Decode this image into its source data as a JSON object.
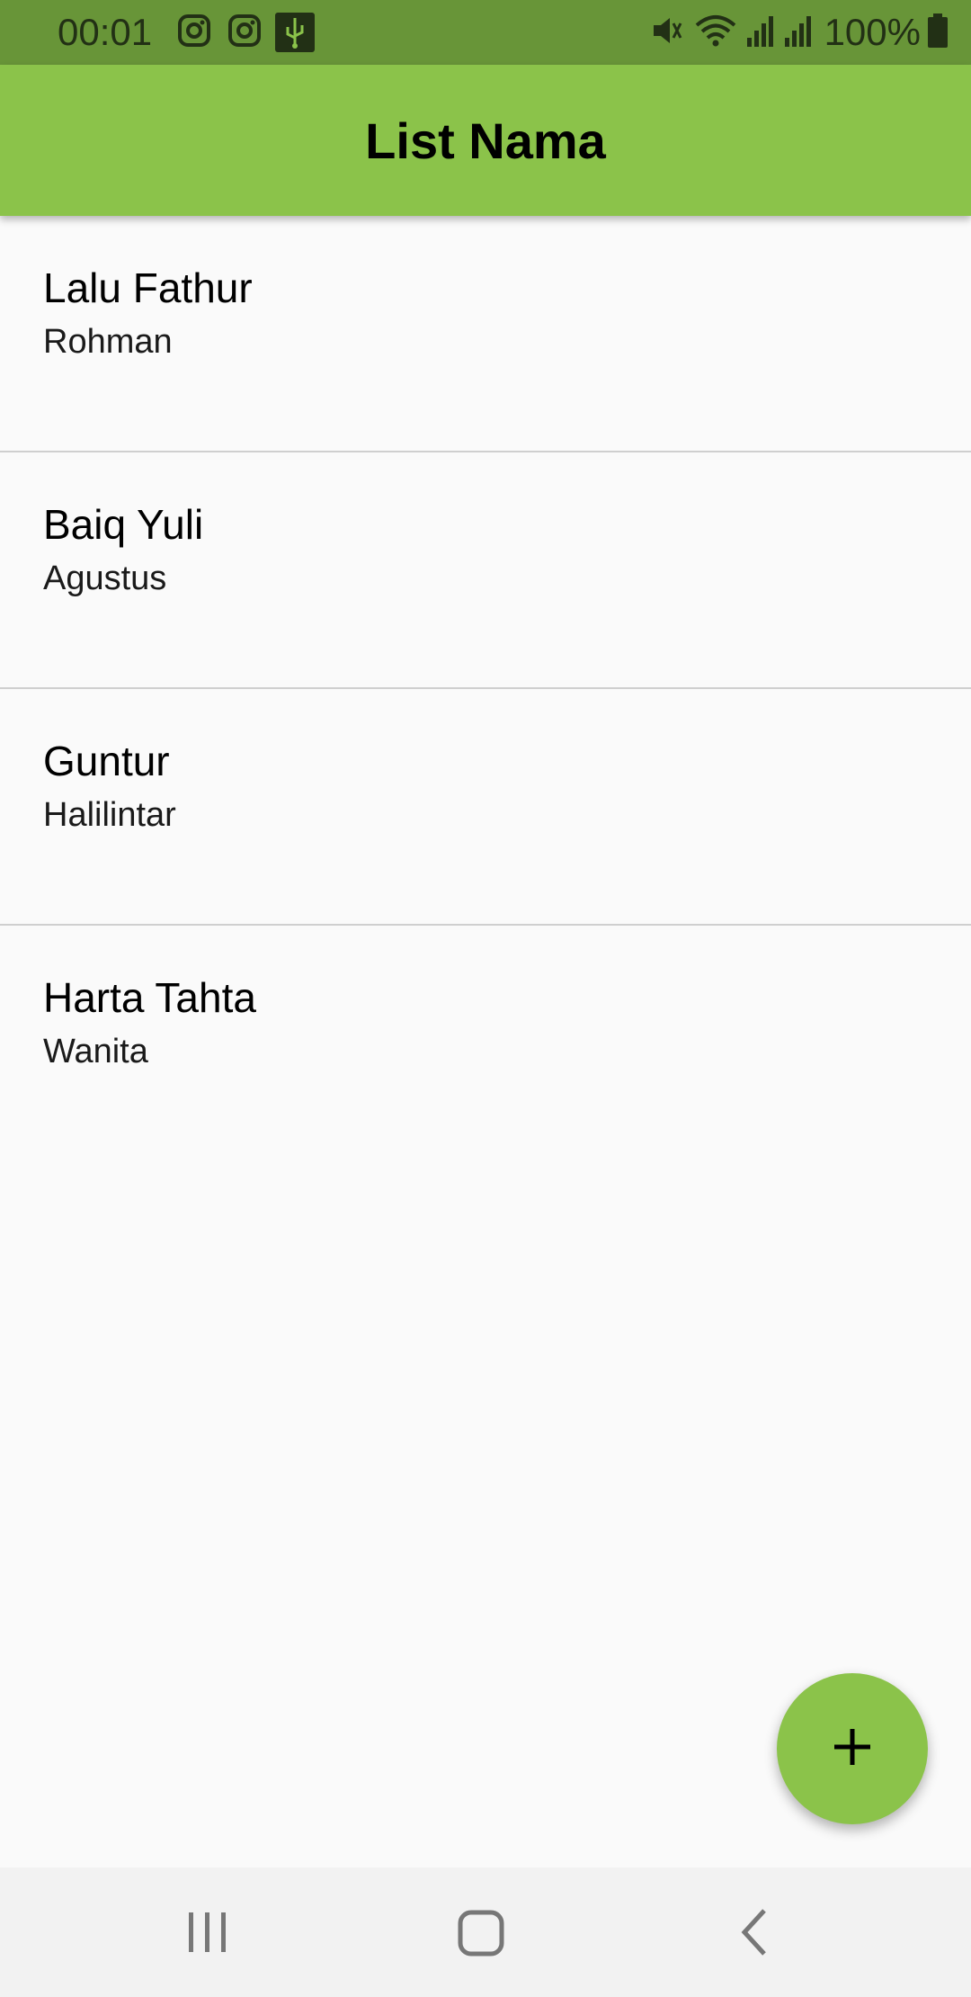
{
  "status_bar": {
    "time": "00:01",
    "battery": "100%",
    "left_icons": [
      "instagram-icon",
      "instagram-icon",
      "usb-icon"
    ],
    "right_icons": [
      "mute-icon",
      "wifi-icon",
      "signal-icon",
      "signal-icon",
      "battery-icon"
    ]
  },
  "app_bar": {
    "title": "List Nama"
  },
  "list": {
    "items": [
      {
        "title": "Lalu Fathur",
        "subtitle": "Rohman"
      },
      {
        "title": "Baiq Yuli",
        "subtitle": "Agustus"
      },
      {
        "title": "Guntur",
        "subtitle": "Halilintar"
      },
      {
        "title": "Harta Tahta",
        "subtitle": "Wanita"
      }
    ]
  },
  "fab": {
    "icon": "plus-icon"
  },
  "nav_bar": {
    "icons": [
      "recent-apps-icon",
      "home-icon",
      "back-icon"
    ]
  },
  "colors": {
    "primary": "#8bc34a",
    "status_bar": "#689538",
    "background": "#fafafa",
    "divider": "#cfcfcf"
  }
}
